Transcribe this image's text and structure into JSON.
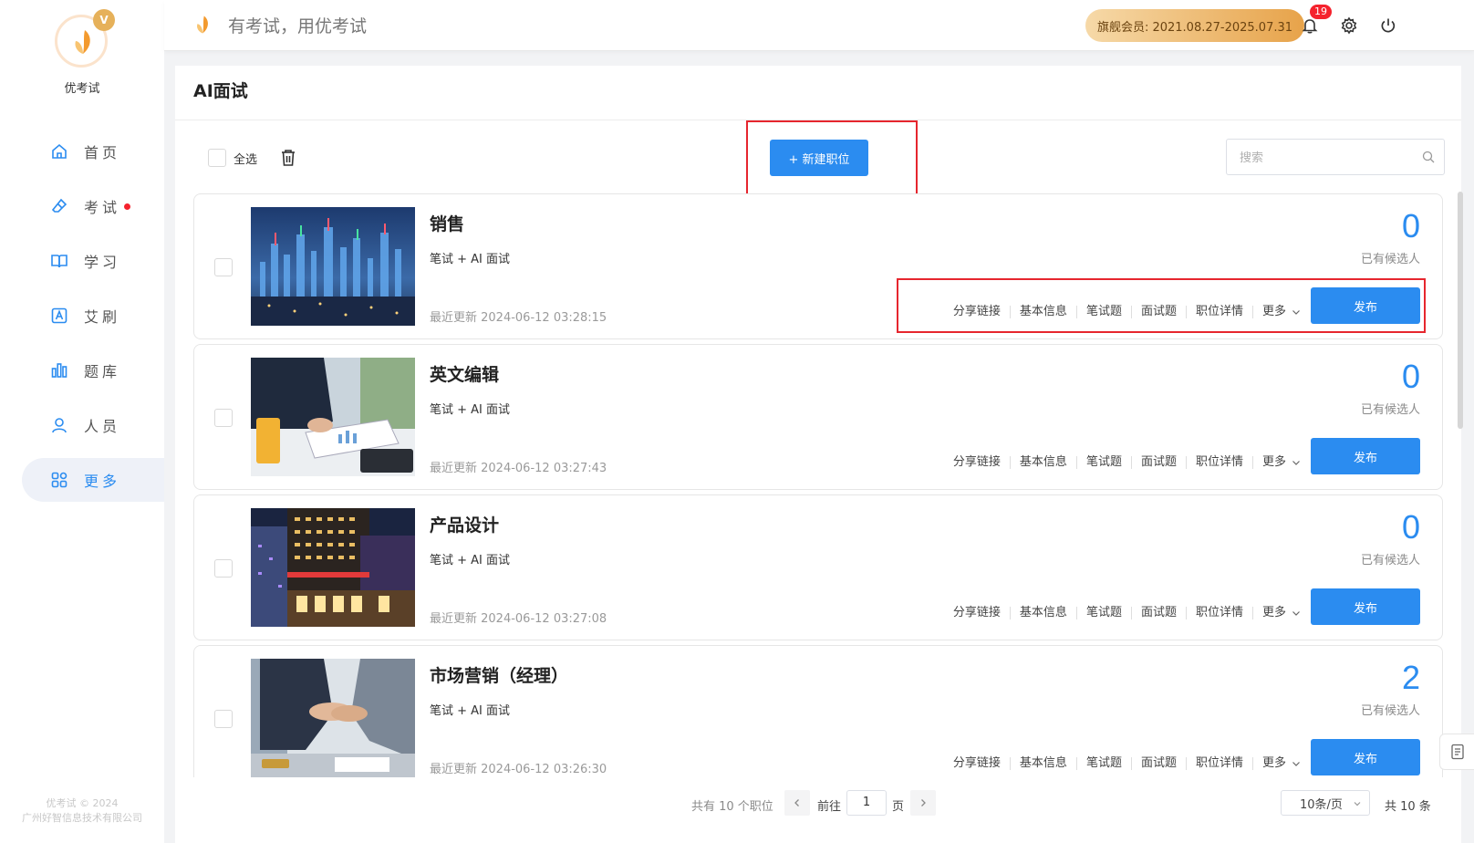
{
  "brand": {
    "name": "优考试",
    "badge": "V",
    "copyright_line1": "优考试 © 2024",
    "copyright_line2": "广州好智信息技术有限公司"
  },
  "nav": {
    "items": [
      {
        "label": "首页",
        "icon": "home-icon"
      },
      {
        "label": "考试",
        "icon": "eraser-icon",
        "dot": true
      },
      {
        "label": "学习",
        "icon": "book-icon"
      },
      {
        "label": "艾刷",
        "icon": "a-square-icon"
      },
      {
        "label": "题库",
        "icon": "bar-chart-icon"
      },
      {
        "label": "人员",
        "icon": "user-icon"
      },
      {
        "label": "更多",
        "icon": "grid-icon",
        "active": true
      }
    ]
  },
  "header": {
    "slogan": "有考试，用优考试",
    "membership": "旗舰会员: 2021.08.27-2025.07.31",
    "notifications": "19"
  },
  "page": {
    "title": "AI面试",
    "select_all": "全选",
    "new_button": "+ 新建职位",
    "search_placeholder": "搜索"
  },
  "positions": [
    {
      "title": "销售",
      "subtitle": "笔试 + AI 面试",
      "updated": "最近更新 2024-06-12 03:28:15",
      "candidates": "0",
      "thumb": "city-night"
    },
    {
      "title": "英文编辑",
      "subtitle": "笔试 + AI 面试",
      "updated": "最近更新 2024-06-12 03:27:43",
      "candidates": "0",
      "thumb": "office-desk"
    },
    {
      "title": "产品设计",
      "subtitle": "笔试 + AI 面试",
      "updated": "最近更新 2024-06-12 03:27:08",
      "candidates": "0",
      "thumb": "building-night"
    },
    {
      "title": "市场营销（经理）",
      "subtitle": "笔试 + AI 面试",
      "updated": "最近更新 2024-06-12 03:26:30",
      "candidates": "2",
      "thumb": "handshake"
    }
  ],
  "card_labels": {
    "candidates_label": "已有候选人",
    "share": "分享链接",
    "basic": "基本信息",
    "written": "笔试题",
    "interview": "面试题",
    "detail": "职位详情",
    "more": "更多",
    "publish": "发布"
  },
  "pagination": {
    "total_text": "共有 10 个职位",
    "goto": "前往",
    "page": "1",
    "unit": "页",
    "page_size": "10条/页",
    "count": "共 10 条"
  },
  "colors": {
    "primary": "#2b8cf0",
    "annotation": "#e6262e",
    "badge": "#f5222d"
  }
}
